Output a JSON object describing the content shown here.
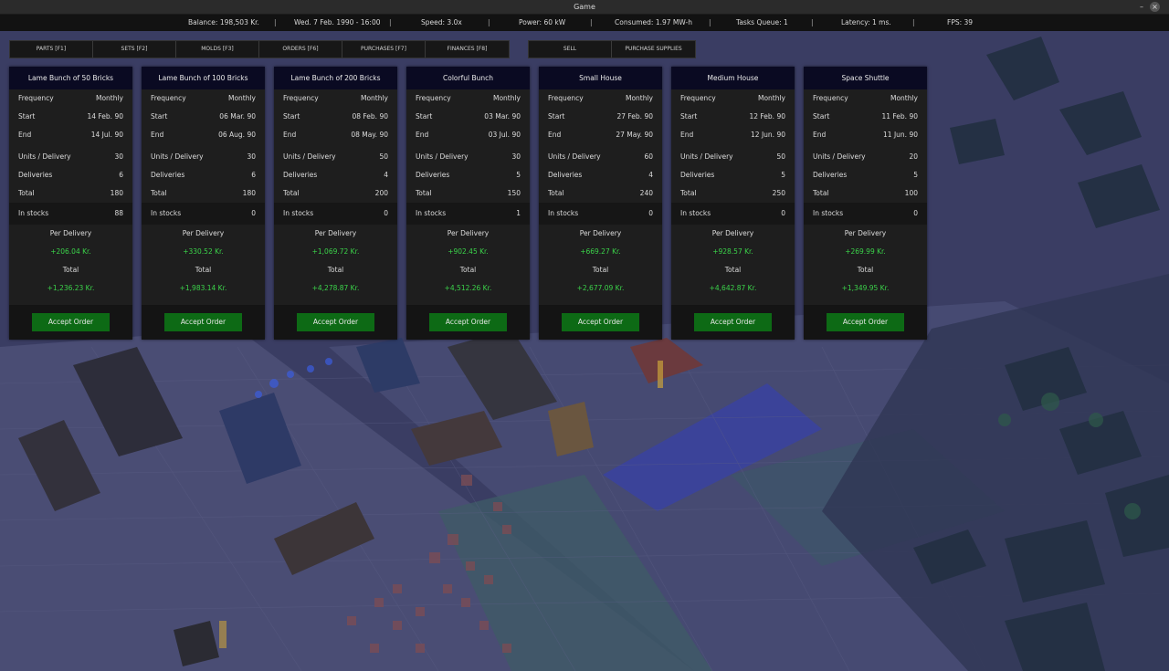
{
  "window": {
    "title": "Game",
    "minimize_glyph": "–",
    "close_glyph": "×"
  },
  "status": {
    "balance": "Balance: 198,503 Kr.",
    "date": "Wed. 7 Feb. 1990 - 16:00",
    "speed": "Speed: 3.0x",
    "power": "Power: 60 kW",
    "consumed": "Consumed: 1.97 MW-h",
    "tasks": "Tasks Queue: 1",
    "latency": "Latency: 1 ms.",
    "fps": "FPS: 39",
    "separator": "|"
  },
  "tabs": {
    "main": [
      "PARTS [F1]",
      "SETS [F2]",
      "MOLDS [F3]",
      "ORDERS [F6]",
      "PURCHASES [F7]",
      "FINANCES [F8]"
    ],
    "secondary": [
      "SELL",
      "PURCHASE SUPPLIES"
    ]
  },
  "labels": {
    "frequency": "Frequency",
    "start": "Start",
    "end": "End",
    "units": "Units / Delivery",
    "deliveries": "Deliveries",
    "total": "Total",
    "in_stocks": "In stocks",
    "per_delivery": "Per Delivery",
    "total_money": "Total",
    "accept": "Accept Order"
  },
  "orders": [
    {
      "title": "Lame Bunch of 50 Bricks",
      "frequency": "Monthly",
      "start": "14 Feb. 90",
      "end": "14 Jul. 90",
      "units": "30",
      "deliveries": "6",
      "total": "180",
      "in_stocks": "88",
      "per_delivery": "+206.04 Kr.",
      "total_money": "+1,236.23 Kr."
    },
    {
      "title": "Lame Bunch of 100 Bricks",
      "frequency": "Monthly",
      "start": "06 Mar. 90",
      "end": "06 Aug. 90",
      "units": "30",
      "deliveries": "6",
      "total": "180",
      "in_stocks": "0",
      "per_delivery": "+330.52 Kr.",
      "total_money": "+1,983.14 Kr."
    },
    {
      "title": "Lame Bunch of 200 Bricks",
      "frequency": "Monthly",
      "start": "08 Feb. 90",
      "end": "08 May. 90",
      "units": "50",
      "deliveries": "4",
      "total": "200",
      "in_stocks": "0",
      "per_delivery": "+1,069.72 Kr.",
      "total_money": "+4,278.87 Kr."
    },
    {
      "title": "Colorful Bunch",
      "frequency": "Monthly",
      "start": "03 Mar. 90",
      "end": "03 Jul. 90",
      "units": "30",
      "deliveries": "5",
      "total": "150",
      "in_stocks": "1",
      "per_delivery": "+902.45 Kr.",
      "total_money": "+4,512.26 Kr."
    },
    {
      "title": "Small House",
      "frequency": "Monthly",
      "start": "27 Feb. 90",
      "end": "27 May. 90",
      "units": "60",
      "deliveries": "4",
      "total": "240",
      "in_stocks": "0",
      "per_delivery": "+669.27 Kr.",
      "total_money": "+2,677.09 Kr."
    },
    {
      "title": "Medium House",
      "frequency": "Monthly",
      "start": "12 Feb. 90",
      "end": "12 Jun. 90",
      "units": "50",
      "deliveries": "5",
      "total": "250",
      "in_stocks": "0",
      "per_delivery": "+928.57 Kr.",
      "total_money": "+4,642.87 Kr."
    },
    {
      "title": "Space Shuttle",
      "frequency": "Monthly",
      "start": "11 Feb. 90",
      "end": "11 Jun. 90",
      "units": "20",
      "deliveries": "5",
      "total": "100",
      "in_stocks": "0",
      "per_delivery": "+269.99 Kr.",
      "total_money": "+1,349.95 Kr."
    }
  ],
  "colors": {
    "card_header": "#0a0a22",
    "money_positive": "#3bd34a",
    "accept_button": "#0d6a15",
    "floor": "#3c3f66"
  }
}
